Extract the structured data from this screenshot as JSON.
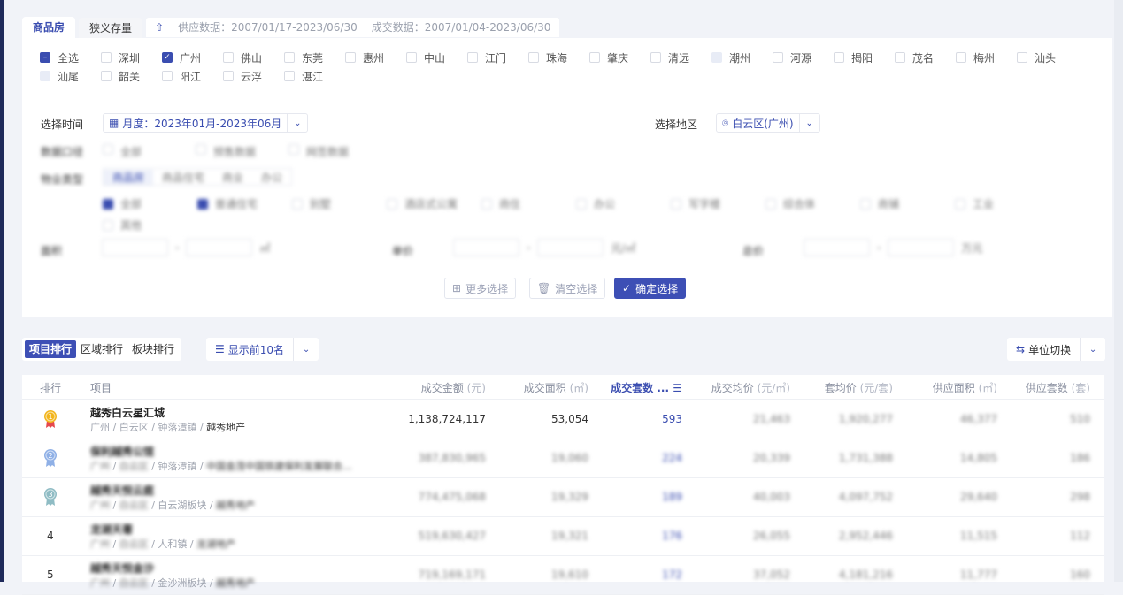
{
  "tabs": [
    {
      "label": "商品房",
      "active": true
    },
    {
      "label": "狭义存量",
      "active": false
    }
  ],
  "data_range": {
    "supply": "供应数据：2007/01/17-2023/06/30",
    "deal": "成交数据：2007/01/04-2023/06/30"
  },
  "cities": [
    {
      "label": "全选",
      "state": "partial"
    },
    {
      "label": "深圳",
      "state": "off"
    },
    {
      "label": "广州",
      "state": "on"
    },
    {
      "label": "佛山",
      "state": "off"
    },
    {
      "label": "东莞",
      "state": "off"
    },
    {
      "label": "惠州",
      "state": "off"
    },
    {
      "label": "中山",
      "state": "off"
    },
    {
      "label": "江门",
      "state": "off"
    },
    {
      "label": "珠海",
      "state": "off"
    },
    {
      "label": "肇庆",
      "state": "off"
    },
    {
      "label": "清远",
      "state": "off"
    },
    {
      "label": "潮州",
      "state": "disabled"
    },
    {
      "label": "河源",
      "state": "off"
    },
    {
      "label": "揭阳",
      "state": "off"
    },
    {
      "label": "茂名",
      "state": "off"
    },
    {
      "label": "梅州",
      "state": "off"
    },
    {
      "label": "汕头",
      "state": "off"
    },
    {
      "label": "汕尾",
      "state": "disabled"
    },
    {
      "label": "韶关",
      "state": "off"
    },
    {
      "label": "阳江",
      "state": "off"
    },
    {
      "label": "云浮",
      "state": "off"
    },
    {
      "label": "湛江",
      "state": "off"
    }
  ],
  "filters": {
    "time_label": "选择时间",
    "time_value": "月度：2023年01月-2023年06月",
    "region_label": "选择地区",
    "region_value": "白云区(广州)",
    "data_type_label": "数据口径",
    "data_type_options": [
      "全部",
      "预售数据",
      "网签数据"
    ],
    "property_label": "物业类型",
    "property_tabs": [
      "商品房",
      "商品住宅",
      "商业",
      "办公"
    ],
    "property_options": [
      "全部",
      "普通住宅",
      "别墅",
      "酒店式公寓",
      "商住",
      "办公",
      "写字楼",
      "综合体",
      "商铺",
      "工业",
      "其他"
    ],
    "area_label": "面积",
    "area_unit": "㎡",
    "price_label": "单价",
    "price_unit": "元/㎡",
    "total_label": "总价",
    "total_unit": "万元",
    "more": "更多选择",
    "clear": "清空选择",
    "confirm": "确定选择"
  },
  "ranking": {
    "tabs": [
      "项目排行",
      "区域排行",
      "板块排行"
    ],
    "top_n": "显示前10名",
    "unit_switch": "单位切换"
  },
  "table": {
    "headers": [
      {
        "label": "排行",
        "unit": ""
      },
      {
        "label": "项目",
        "unit": ""
      },
      {
        "label": "成交金额",
        "unit": "(元)"
      },
      {
        "label": "成交面积",
        "unit": "(㎡)"
      },
      {
        "label": "成交套数 ...",
        "unit": ""
      },
      {
        "label": "成交均价",
        "unit": "(元/㎡)"
      },
      {
        "label": "套均价",
        "unit": "(元/套)"
      },
      {
        "label": "供应面积",
        "unit": "(㎡)"
      },
      {
        "label": "供应套数",
        "unit": "(套)"
      }
    ],
    "rows": [
      {
        "rank": "1",
        "name": "越秀白云星汇城",
        "city": "广州",
        "district": "白云区",
        "block": "钟落潭镇",
        "dev": "越秀地产",
        "amount": "1,138,724,117",
        "area": "53,054",
        "units": "593",
        "avg": "21,463",
        "avg_unit": "1,920,277",
        "sup_area": "46,377",
        "sup_units": "510"
      },
      {
        "rank": "2",
        "name": "保利越秀公馆",
        "city": "广州",
        "district": "白云区",
        "block": "钟落潭镇",
        "dev": "中国金茂中国铁建保利发展联合...",
        "amount": "387,830,965",
        "area": "19,060",
        "units": "224",
        "avg": "20,339",
        "avg_unit": "1,731,388",
        "sup_area": "14,805",
        "sup_units": "186"
      },
      {
        "rank": "3",
        "name": "越秀天悦云庭",
        "city": "广州",
        "district": "白云区",
        "block": "白云湖板块",
        "dev": "越秀地产",
        "amount": "774,475,068",
        "area": "19,329",
        "units": "189",
        "avg": "40,003",
        "avg_unit": "4,097,752",
        "sup_area": "29,640",
        "sup_units": "298"
      },
      {
        "rank": "4",
        "name": "龙湖天著",
        "city": "广州",
        "district": "白云区",
        "block": "人和镇",
        "dev": "龙湖地产",
        "amount": "519,630,427",
        "area": "19,321",
        "units": "176",
        "avg": "26,055",
        "avg_unit": "2,952,446",
        "sup_area": "11,515",
        "sup_units": "112"
      },
      {
        "rank": "5",
        "name": "越秀天悦金沙",
        "city": "广州",
        "district": "白云区",
        "block": "金沙洲板块",
        "dev": "越秀地产",
        "amount": "719,169,171",
        "area": "19,610",
        "units": "172",
        "avg": "37,052",
        "avg_unit": "4,181,216",
        "sup_area": "11,777",
        "sup_units": "160"
      }
    ]
  },
  "colors": {
    "accent": "#3d4fb5",
    "gold": "#f2b51c",
    "silver": "#8fb0e6",
    "bronze": "#8fbcc4"
  }
}
